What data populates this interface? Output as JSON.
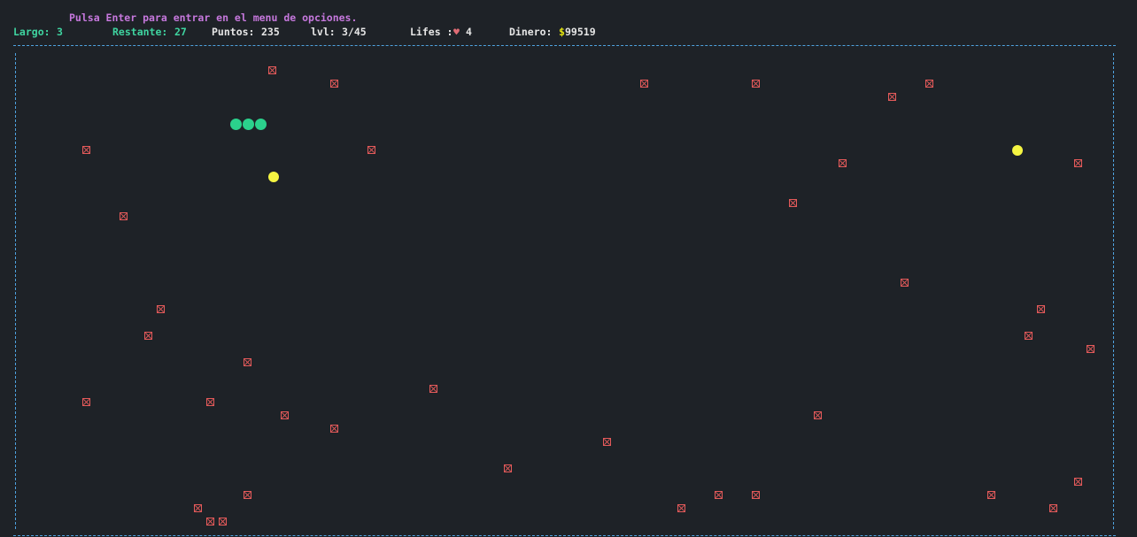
{
  "hint": "Pulsa Enter para entrar en el menu de opciones.",
  "status": {
    "largo_label": "Largo:",
    "largo_value": "3",
    "restante_label": "Restante:",
    "restante_value": "27",
    "puntos_label": "Puntos:",
    "puntos_value": "235",
    "lvl_label": "lvl:",
    "lvl_value": "3/45",
    "lifes_label": "Lifes :",
    "lifes_icon": "♥",
    "lifes_value": "4",
    "dinero_label": "Dinero:",
    "dinero_symbol": "$",
    "dinero_value": "99519"
  },
  "colors": {
    "background": "#1e2227",
    "hint": "#c678dd",
    "status_green": "#3fd4a0",
    "status_white": "#e6e6e6",
    "heart": "#e06c75",
    "dollar": "#e5e510",
    "border": "#4fa3e0",
    "obstacle": "#e45a5a",
    "snake": "#2bd18c",
    "food": "#f5f542"
  },
  "board": {
    "snake_length": 3,
    "food_count": 2,
    "obstacle_icon": "boxed-x-icon"
  }
}
